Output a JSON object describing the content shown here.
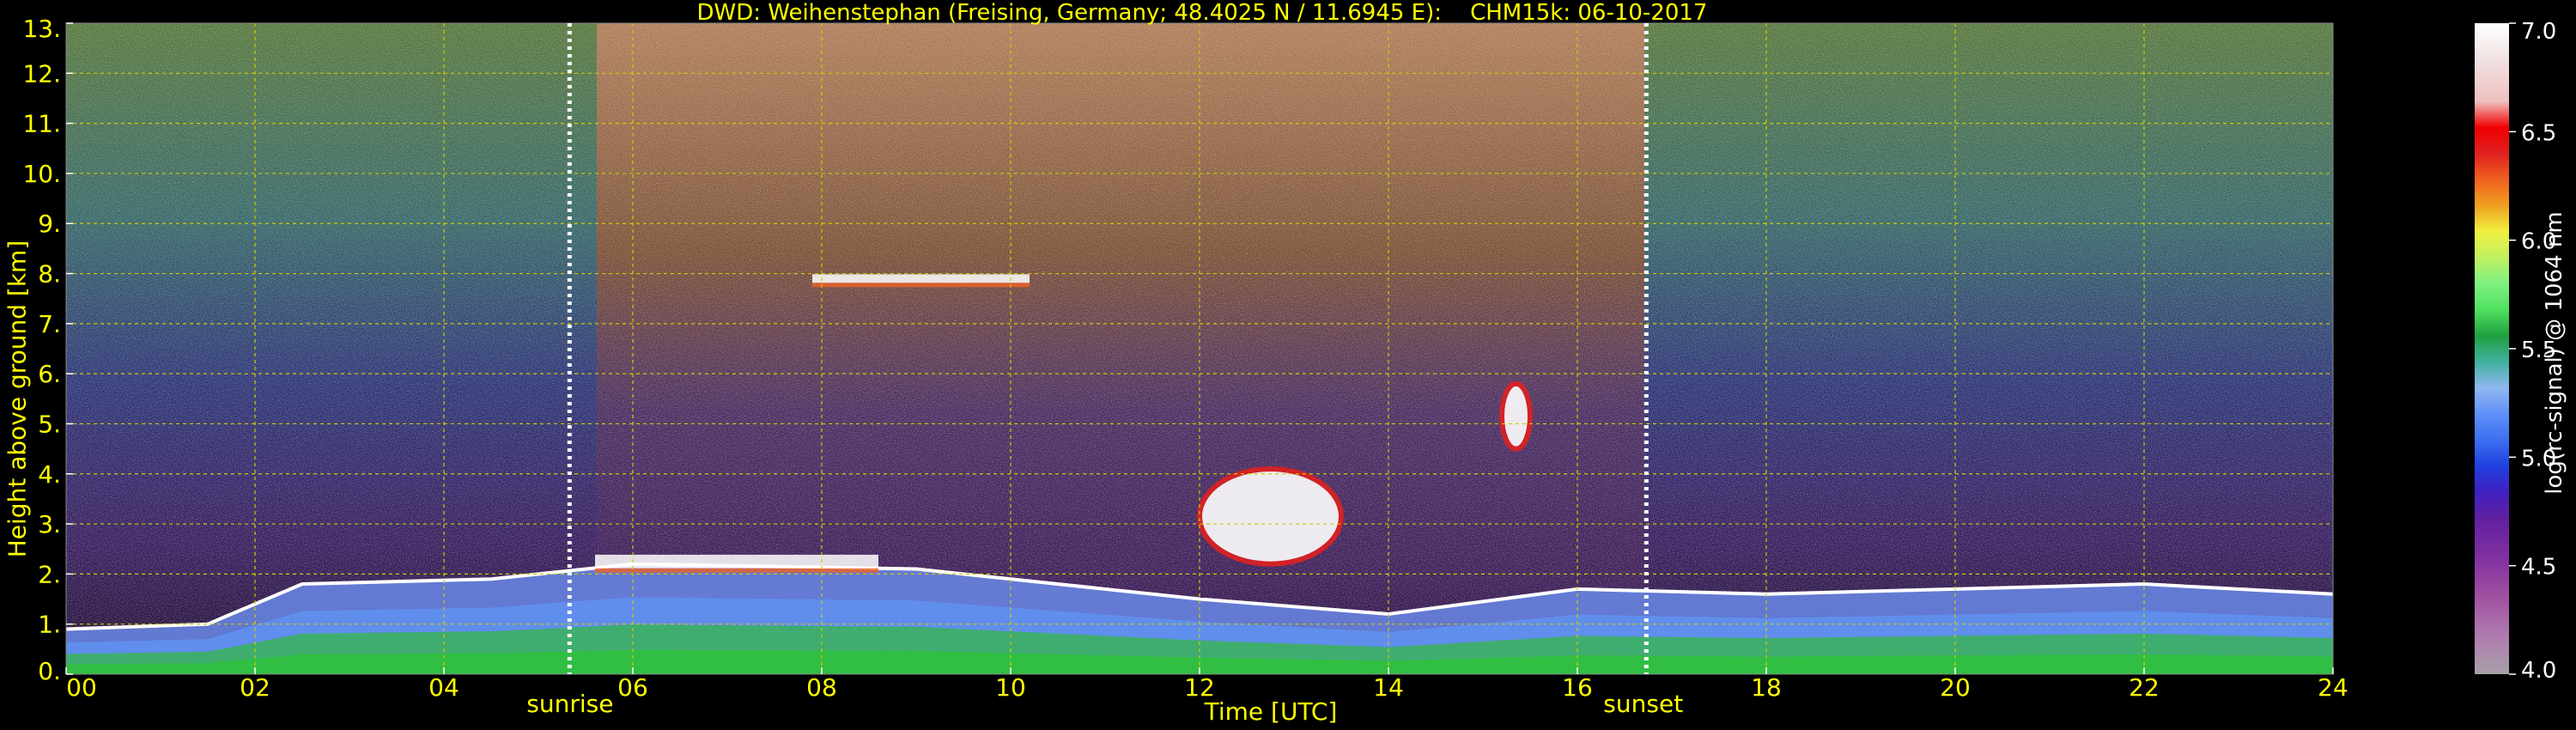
{
  "title": "DWD: Weihenstephan (Freising, Germany; 48.4025 N / 11.6945 E):    CHM15k: 06-10-2017",
  "chart_data": {
    "type": "heatmap",
    "title": "DWD: Weihenstephan (Freising, Germany; 48.4025 N / 11.6945 E):    CHM15k: 06-10-2017",
    "xlabel": "Time [UTC]",
    "ylabel": "Height above ground [km]",
    "colorbar_label": "log(rc-signal) @ 1064 nm",
    "xlim": [
      0,
      24
    ],
    "ylim": [
      0,
      13
    ],
    "clim": [
      4.0,
      7.0
    ],
    "x_ticks": [
      "00",
      "02",
      "04",
      "06",
      "08",
      "10",
      "12",
      "14",
      "16",
      "18",
      "20",
      "22",
      "24"
    ],
    "y_ticks": [
      "0.",
      "1.",
      "2.",
      "3.",
      "4.",
      "5.",
      "6.",
      "7.",
      "8.",
      "9.",
      "10.",
      "11.",
      "12.",
      "13."
    ],
    "colorbar_ticks": [
      "4.0",
      "4.5",
      "5.0",
      "5.5",
      "6.0",
      "6.5",
      "7.0"
    ],
    "grid": true,
    "markers": [
      {
        "label": "sunrise",
        "x": 5.33
      },
      {
        "label": "sunset",
        "x": 16.73
      }
    ],
    "features": [
      {
        "name": "boundary layer top",
        "x": [
          0,
          1.5,
          2.5,
          4.5,
          6,
          9,
          12,
          14,
          16,
          18,
          20,
          22,
          24
        ],
        "y": [
          0.9,
          1.0,
          1.8,
          1.9,
          2.2,
          2.1,
          1.5,
          1.2,
          1.7,
          1.6,
          1.7,
          1.8,
          1.6
        ]
      },
      {
        "name": "cloud layer",
        "x": [
          7.9,
          10.2
        ],
        "y": [
          7.9,
          7.9
        ]
      },
      {
        "name": "cloud layer",
        "x": [
          5.6,
          8.6
        ],
        "y": [
          2.2,
          2.3
        ]
      },
      {
        "name": "convective cloud",
        "x": [
          12.0,
          13.5
        ],
        "y": [
          2.2,
          4.1
        ]
      },
      {
        "name": "convective cloud",
        "x": [
          15.2,
          15.5
        ],
        "y": [
          4.5,
          5.8
        ]
      }
    ]
  },
  "colors": {
    "text": "#ffff00",
    "grid": "#cccc00",
    "colorbar": [
      "#a8a0a8",
      "#b07ab0",
      "#a050a0",
      "#8030a0",
      "#6020a0",
      "#4020c0",
      "#2040e0",
      "#3c70f0",
      "#6090f8",
      "#80a8f8",
      "#90b8f0",
      "#40b0a0",
      "#20a040",
      "#30c030",
      "#50e060",
      "#80f080",
      "#c0f060",
      "#f0f040",
      "#f0d020",
      "#f0a020",
      "#f06020",
      "#e02020",
      "#f00000",
      "#f0c0c0",
      "#f0e0e0",
      "#ffffff"
    ]
  }
}
